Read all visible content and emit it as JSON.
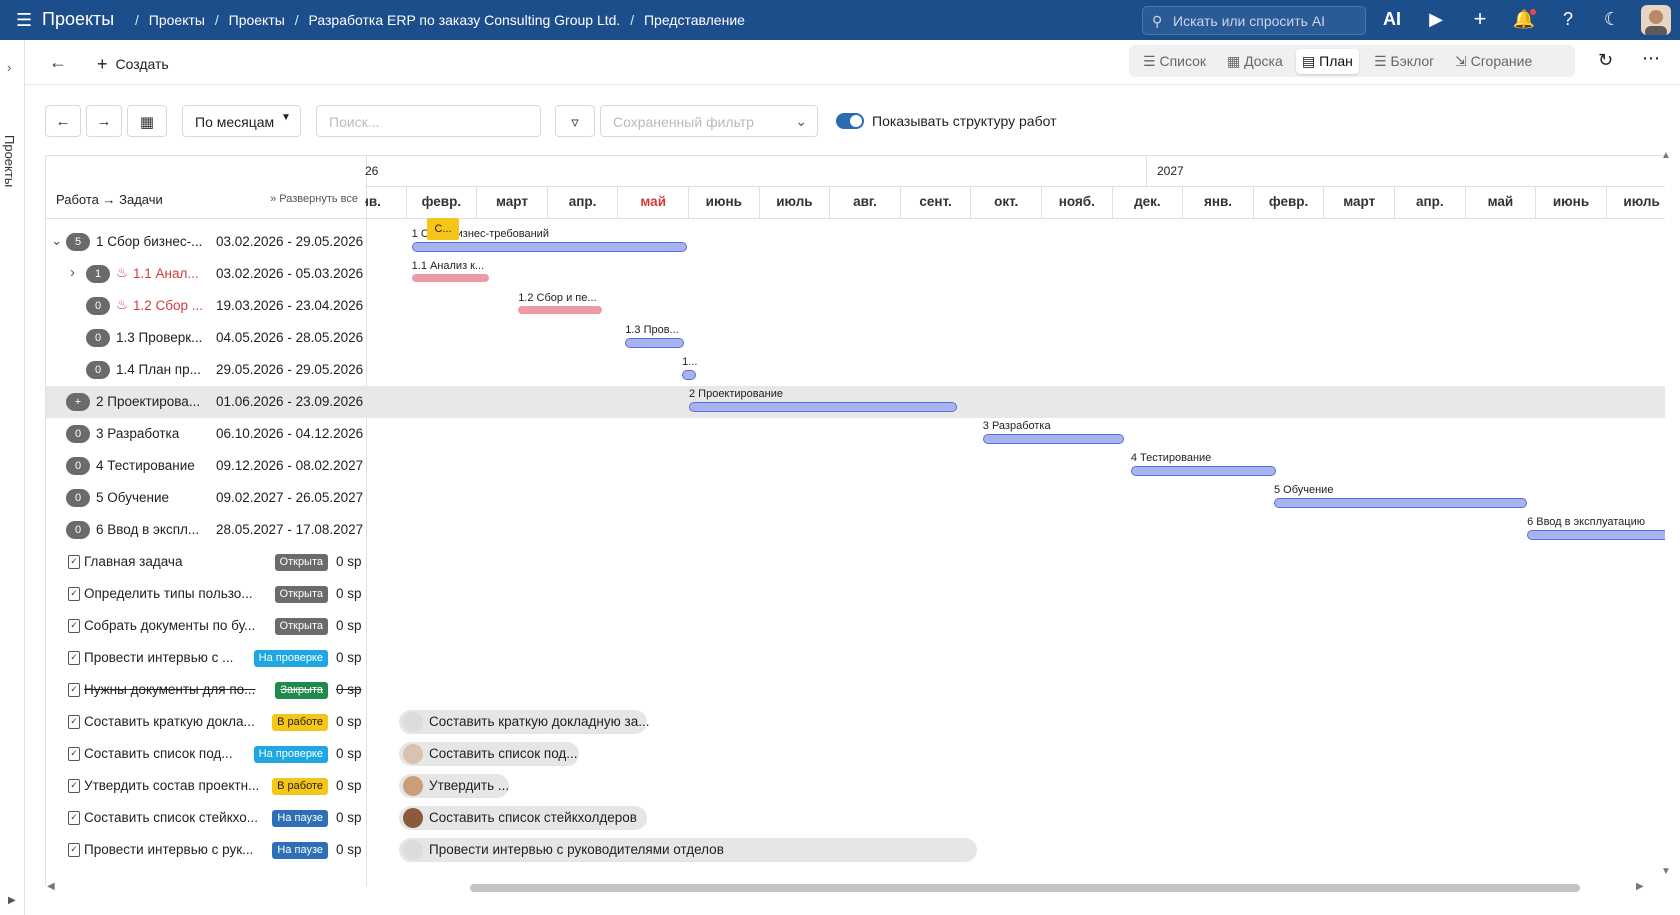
{
  "topbar": {
    "app_title": "Проекты",
    "breadcrumbs": [
      "Проекты",
      "Проекты",
      "Разработка ERP по заказу Consulting Group Ltd.",
      "Представление"
    ],
    "search_placeholder": "Искать или спросить AI",
    "ai_label": "AI"
  },
  "leftrail": {
    "label": "Проекты"
  },
  "secondbar": {
    "create_label": "Создать",
    "views": [
      {
        "label": "Список",
        "active": false
      },
      {
        "label": "Доска",
        "active": false
      },
      {
        "label": "План",
        "active": true
      },
      {
        "label": "Бэклог",
        "active": false
      },
      {
        "label": "Сгорание",
        "active": false
      }
    ]
  },
  "toolbar": {
    "scale_label": "По месяцам",
    "search_placeholder": "Поиск...",
    "saved_filter_placeholder": "Сохраненный фильтр",
    "show_structure_label": "Показывать структуру работ",
    "show_structure_on": true
  },
  "leftpanel": {
    "header": "Работа → Задачи",
    "expand_all": "Развернуть все",
    "groups": [
      {
        "count": "5",
        "name": "1 Сбор бизнес-...",
        "dates": "03.02.2026 - 29.05.2026",
        "level": 0,
        "expanded": true
      },
      {
        "count": "1",
        "name": "1.1 Анал...",
        "dates": "03.02.2026 - 05.03.2026",
        "level": 1,
        "urgent": true
      },
      {
        "count": "0",
        "name": "1.2 Сбор ...",
        "dates": "19.03.2026 - 23.04.2026",
        "level": 1,
        "urgent": true
      },
      {
        "count": "0",
        "name": "1.3 Проверк...",
        "dates": "04.05.2026 - 28.05.2026",
        "level": 1
      },
      {
        "count": "0",
        "name": "1.4 План пр...",
        "dates": "29.05.2026 - 29.05.2026",
        "level": 1
      },
      {
        "count": "+",
        "name": "2 Проектирова...",
        "dates": "01.06.2026 - 23.09.2026",
        "level": 0,
        "highlighted": true
      },
      {
        "count": "0",
        "name": "3 Разработка",
        "dates": "06.10.2026 - 04.12.2026",
        "level": 0
      },
      {
        "count": "0",
        "name": "4 Тестирование",
        "dates": "09.12.2026 - 08.02.2027",
        "level": 0
      },
      {
        "count": "0",
        "name": "5 Обучение",
        "dates": "09.02.2027 - 26.05.2027",
        "level": 0
      },
      {
        "count": "0",
        "name": "6 Ввод в экспл...",
        "dates": "28.05.2027 - 17.08.2027",
        "level": 0
      }
    ],
    "tasks": [
      {
        "name": "Главная задача",
        "status": "Открыта",
        "status_color": "#6b6b6b",
        "sp": "0 sp"
      },
      {
        "name": "Определить типы пользо...",
        "status": "Открыта",
        "status_color": "#6b6b6b",
        "sp": "0 sp"
      },
      {
        "name": "Собрать документы по бу...",
        "status": "Открыта",
        "status_color": "#6b6b6b",
        "sp": "0 sp"
      },
      {
        "name": "Провести интервью с ...",
        "status": "На проверке",
        "status_color": "#1ea7e1",
        "sp": "0 sp"
      },
      {
        "name": "Нужны документы для по...",
        "status": "Закрыта",
        "status_color": "#1f8a4c",
        "sp": "0 sp",
        "closed": true
      },
      {
        "name": "Составить краткую докла...",
        "status": "В работе",
        "status_color": "#f5c518",
        "sp": "0 sp"
      },
      {
        "name": "Составить список под...",
        "status": "На проверке",
        "status_color": "#1ea7e1",
        "sp": "0 sp"
      },
      {
        "name": "Утвердить состав проектн...",
        "status": "В работе",
        "status_color": "#f5c518",
        "sp": "0 sp"
      },
      {
        "name": "Составить список стейкхо...",
        "status": "На паузе",
        "status_color": "#2f6fb5",
        "sp": "0 sp"
      },
      {
        "name": "Провести интервью с рук...",
        "status": "На паузе",
        "status_color": "#2f6fb5",
        "sp": "0 sp"
      }
    ]
  },
  "gantt": {
    "years": [
      "26",
      "2027"
    ],
    "months": [
      "нв.",
      "февр.",
      "март",
      "апр.",
      "май",
      "июнь",
      "июль",
      "авг.",
      "сент.",
      "окт.",
      "нояб.",
      "дек.",
      "янв.",
      "февр.",
      "март",
      "апр.",
      "май",
      "июнь",
      "июль"
    ],
    "current_month_index": 4,
    "milestone_label": "С...",
    "bars": [
      {
        "label": "1 Сбор бизнес-требований",
        "start": "2026-02-03",
        "end": "2026-05-29",
        "color": "blue"
      },
      {
        "label": "1.1 Анализ к...",
        "start": "2026-02-03",
        "end": "2026-03-05",
        "color": "red"
      },
      {
        "label": "1.2 Сбор и пе...",
        "start": "2026-03-19",
        "end": "2026-04-23",
        "color": "red"
      },
      {
        "label": "1.3 Пров...",
        "start": "2026-05-04",
        "end": "2026-05-28",
        "color": "blue"
      },
      {
        "label": "1...",
        "start": "2026-05-29",
        "end": "2026-05-29",
        "color": "blue"
      },
      {
        "label": "2 Проектирование",
        "start": "2026-06-01",
        "end": "2026-09-23",
        "color": "blue"
      },
      {
        "label": "3 Разработка",
        "start": "2026-10-06",
        "end": "2026-12-04",
        "color": "blue"
      },
      {
        "label": "4 Тестирование",
        "start": "2026-12-09",
        "end": "2027-02-08",
        "color": "blue"
      },
      {
        "label": "5 Обучение",
        "start": "2027-02-09",
        "end": "2027-05-26",
        "color": "blue"
      },
      {
        "label": "6 Ввод в эксплуатацию",
        "start": "2027-05-28",
        "end": "2027-08-17",
        "color": "blue"
      }
    ],
    "chips": [
      {
        "label": "Составить краткую докладную за..."
      },
      {
        "label": "Составить список под..."
      },
      {
        "label": "Утвердить ..."
      },
      {
        "label": "Составить список стейкхолдеров"
      },
      {
        "label": "Провести интервью с руководителями отделов"
      }
    ]
  }
}
